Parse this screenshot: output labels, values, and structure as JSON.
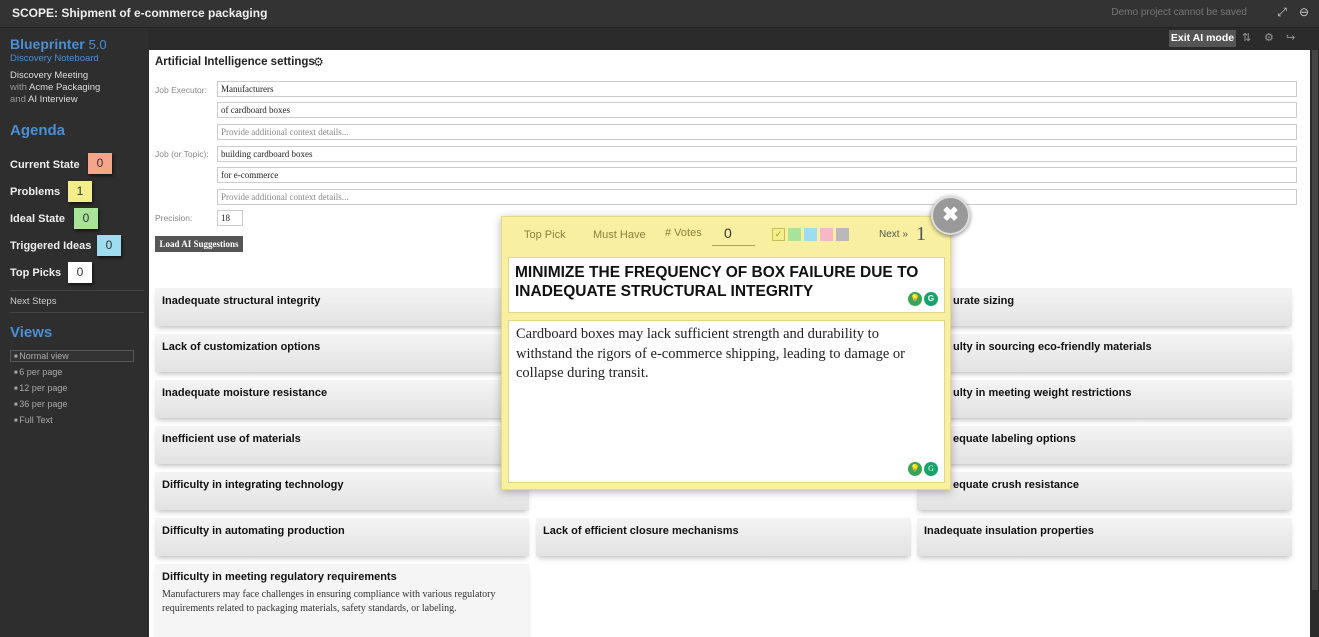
{
  "topbar": {
    "title": "SCOPE: Shipment of e-commerce packaging",
    "demo_note": "Demo project cannot be saved"
  },
  "sidebar": {
    "brand": "Blueprinter",
    "version": "5.0",
    "subtitle": "Discovery Noteboard",
    "meeting_line1": "Discovery Meeting",
    "meeting_with": "with",
    "meeting_company": "Acme Packaging",
    "meeting_and": "and",
    "meeting_ai": "AI Interview",
    "agenda_heading": "Agenda",
    "agenda": [
      {
        "label": "Current State",
        "count": "0",
        "color": "#f5a58a"
      },
      {
        "label": "Problems",
        "count": "1",
        "color": "#f3ee8c"
      },
      {
        "label": "Ideal State",
        "count": "0",
        "color": "#a7e49a"
      },
      {
        "label": "Triggered Ideas",
        "count": "0",
        "color": "#9edcf0"
      },
      {
        "label": "Top Picks",
        "count": "0",
        "color": "#ffffff"
      }
    ],
    "next_steps": "Next Steps",
    "views_heading": "Views",
    "views": [
      "Normal view",
      "6 per page",
      "12 per page",
      "36 per page",
      "Full Text"
    ]
  },
  "header": {
    "exit_ai": "Exit AI mode"
  },
  "ai_settings": {
    "title": "Artificial Intelligence settings",
    "job_executor_label": "Job Executor:",
    "job_executor_1": "Manufacturers",
    "job_executor_2": "of cardboard boxes",
    "context_placeholder": "Provide additional context details...",
    "job_topic_label": "Job (or Topic):",
    "job_topic_1": "building cardboard boxes",
    "job_topic_2": "for e-commerce",
    "precision_label": "Precision:",
    "precision_value": "18",
    "load_button": "Load AI Suggestions"
  },
  "cards": {
    "c1": "Inadequate structural integrity",
    "c2": "urate sizing",
    "c3": "Lack of customization options",
    "c4": "ulty in sourcing eco-friendly materials",
    "c5": "Inadequate moisture resistance",
    "c6": "ulty in meeting weight restrictions",
    "c7": "Inefficient use of materials",
    "c8": "equate labeling options",
    "c9": "Difficulty in integrating technology",
    "c10": "equate crush resistance",
    "c11": "Difficulty in automating production",
    "c12": "Lack of efficient closure mechanisms",
    "c13": "Inadequate insulation properties",
    "c14": "Difficulty in meeting regulatory requirements",
    "c14_desc": "Manufacturers may face challenges in ensuring compliance with various regulatory requirements related to packaging materials, safety standards, or labeling."
  },
  "popup": {
    "top_pick": "Top Pick",
    "must_have": "Must Have",
    "votes_label": "# Votes",
    "votes_value": "0",
    "next": "Next »",
    "next_num": "1",
    "title": "MINIMIZE THE FREQUENCY OF BOX FAILURE DUE TO INADEQUATE STRUCTURAL INTEGRITY",
    "body": "Cardboard boxes may lack sufficient strength and durability to withstand the rigors of e-commerce shipping, leading to damage or collapse during transit."
  }
}
